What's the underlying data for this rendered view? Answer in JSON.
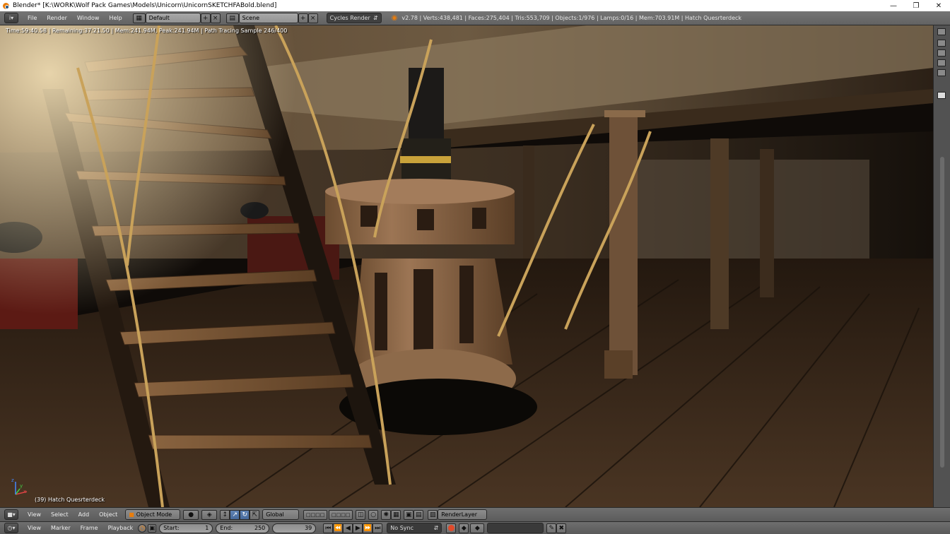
{
  "window": {
    "title": "Blender* [K:\\WORK\\Wolf Pack Games\\Models\\Unicorn\\UnicornSKETCHFABold.blend]",
    "minimize": "—",
    "maximize": "❐",
    "close": "✕"
  },
  "info_header": {
    "editor_icon": "i",
    "menus": [
      "File",
      "Render",
      "Window",
      "Help"
    ],
    "screen_layout": "Default",
    "scene": "Scene",
    "render_engine": "Cycles Render",
    "stats": "v2.78 | Verts:438,481 | Faces:275,404 | Tris:553,709 | Objects:1/976 | Lamps:0/16 | Mem:703.91M | Hatch Quesrterdeck"
  },
  "viewport": {
    "render_info": "Time:59:40.58 | Remaining:37:21.50 | Mem:241.94M, Peak:241.94M | Path Tracing Sample 246/400",
    "object_label": "(39) Hatch Quesrterdeck",
    "axis_x": "x",
    "axis_y": "y",
    "axis_z": "z"
  },
  "view_header": {
    "menus": [
      "View",
      "Select",
      "Add",
      "Object"
    ],
    "mode": "Object Mode",
    "transform_orientation": "Global",
    "render_layer": "RenderLayer"
  },
  "timeline": {
    "menus": [
      "View",
      "Marker",
      "Frame",
      "Playback"
    ],
    "start_label": "Start:",
    "start_value": "1",
    "end_label": "End:",
    "end_value": "250",
    "current_frame": "39",
    "sync": "No Sync"
  },
  "colors": {
    "ui_header": "#626262",
    "selected_blue": "#5680c2",
    "wood_light": "#b58b5c",
    "wood_dark": "#3b2716",
    "rope": "#c9a25a",
    "record_red": "#e04a2a"
  }
}
